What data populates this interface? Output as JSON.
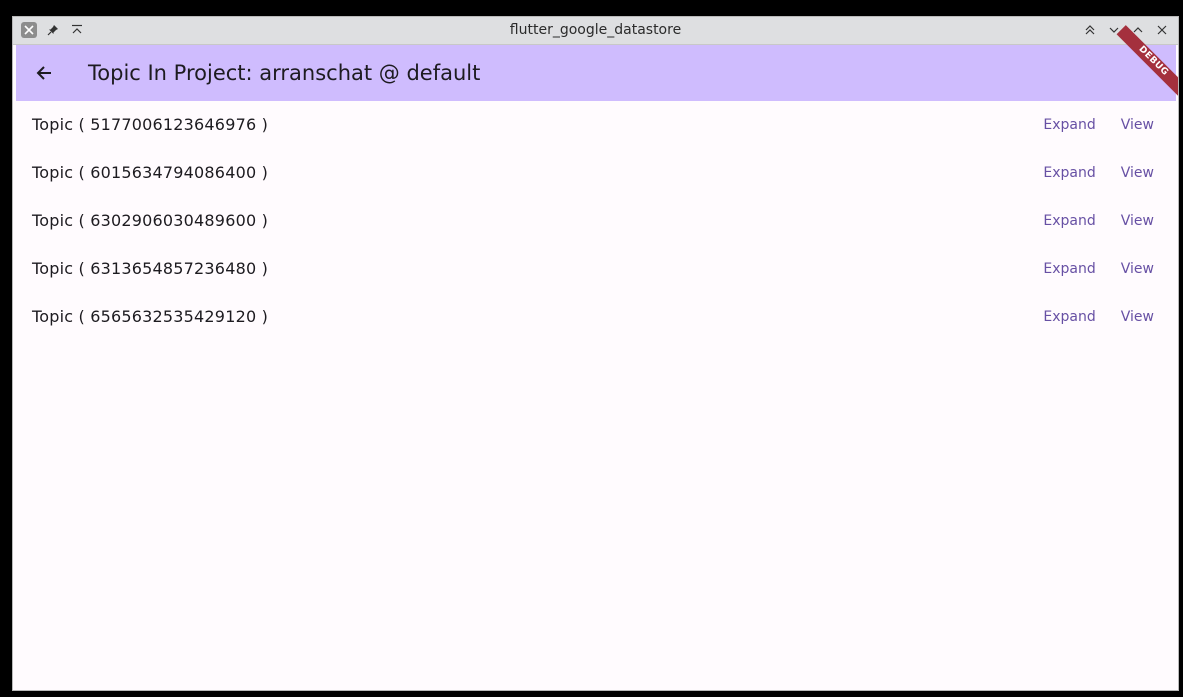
{
  "window": {
    "title": "flutter_google_datastore"
  },
  "appbar": {
    "title": "Topic In Project: arranschat @ default",
    "debug_banner": "DEBUG"
  },
  "topics": [
    {
      "label": "Topic ( 5177006123646976 )",
      "expand_label": "Expand",
      "view_label": "View"
    },
    {
      "label": "Topic ( 6015634794086400 )",
      "expand_label": "Expand",
      "view_label": "View"
    },
    {
      "label": "Topic ( 6302906030489600 )",
      "expand_label": "Expand",
      "view_label": "View"
    },
    {
      "label": "Topic ( 6313654857236480 )",
      "expand_label": "Expand",
      "view_label": "View"
    },
    {
      "label": "Topic ( 6565632535429120 )",
      "expand_label": "Expand",
      "view_label": "View"
    }
  ],
  "colors": {
    "appbar_bg": "#cfbcfe",
    "body_bg": "#fffbfe",
    "button_text": "#6750a4",
    "debug_banner": "#a4303d"
  }
}
